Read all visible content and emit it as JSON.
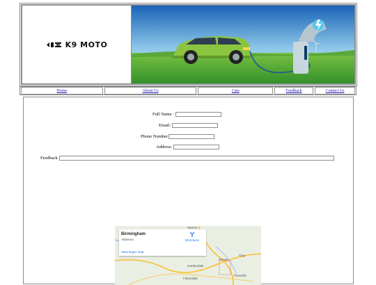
{
  "header": {
    "logo_text": "K9 MOTO"
  },
  "nav": {
    "items": [
      {
        "label": "Home"
      },
      {
        "label": "About Us"
      },
      {
        "label": "Cars"
      },
      {
        "label": "Feedback"
      },
      {
        "label": "Contact Us"
      }
    ]
  },
  "form": {
    "full_name_label": "Full Name :",
    "email_label": "Email:",
    "phone_label": "Phone Number",
    "address_label": "Address:",
    "feedback_label": "Feedback"
  },
  "map": {
    "place_name": "Birmingham",
    "place_region": "Alabama",
    "directions_label": "Directions",
    "view_larger_label": "View larger map",
    "town_labels": [
      "Clay",
      "Pinson",
      "Gardendale",
      "Fultondale",
      "Trussville",
      "Warrior"
    ]
  }
}
